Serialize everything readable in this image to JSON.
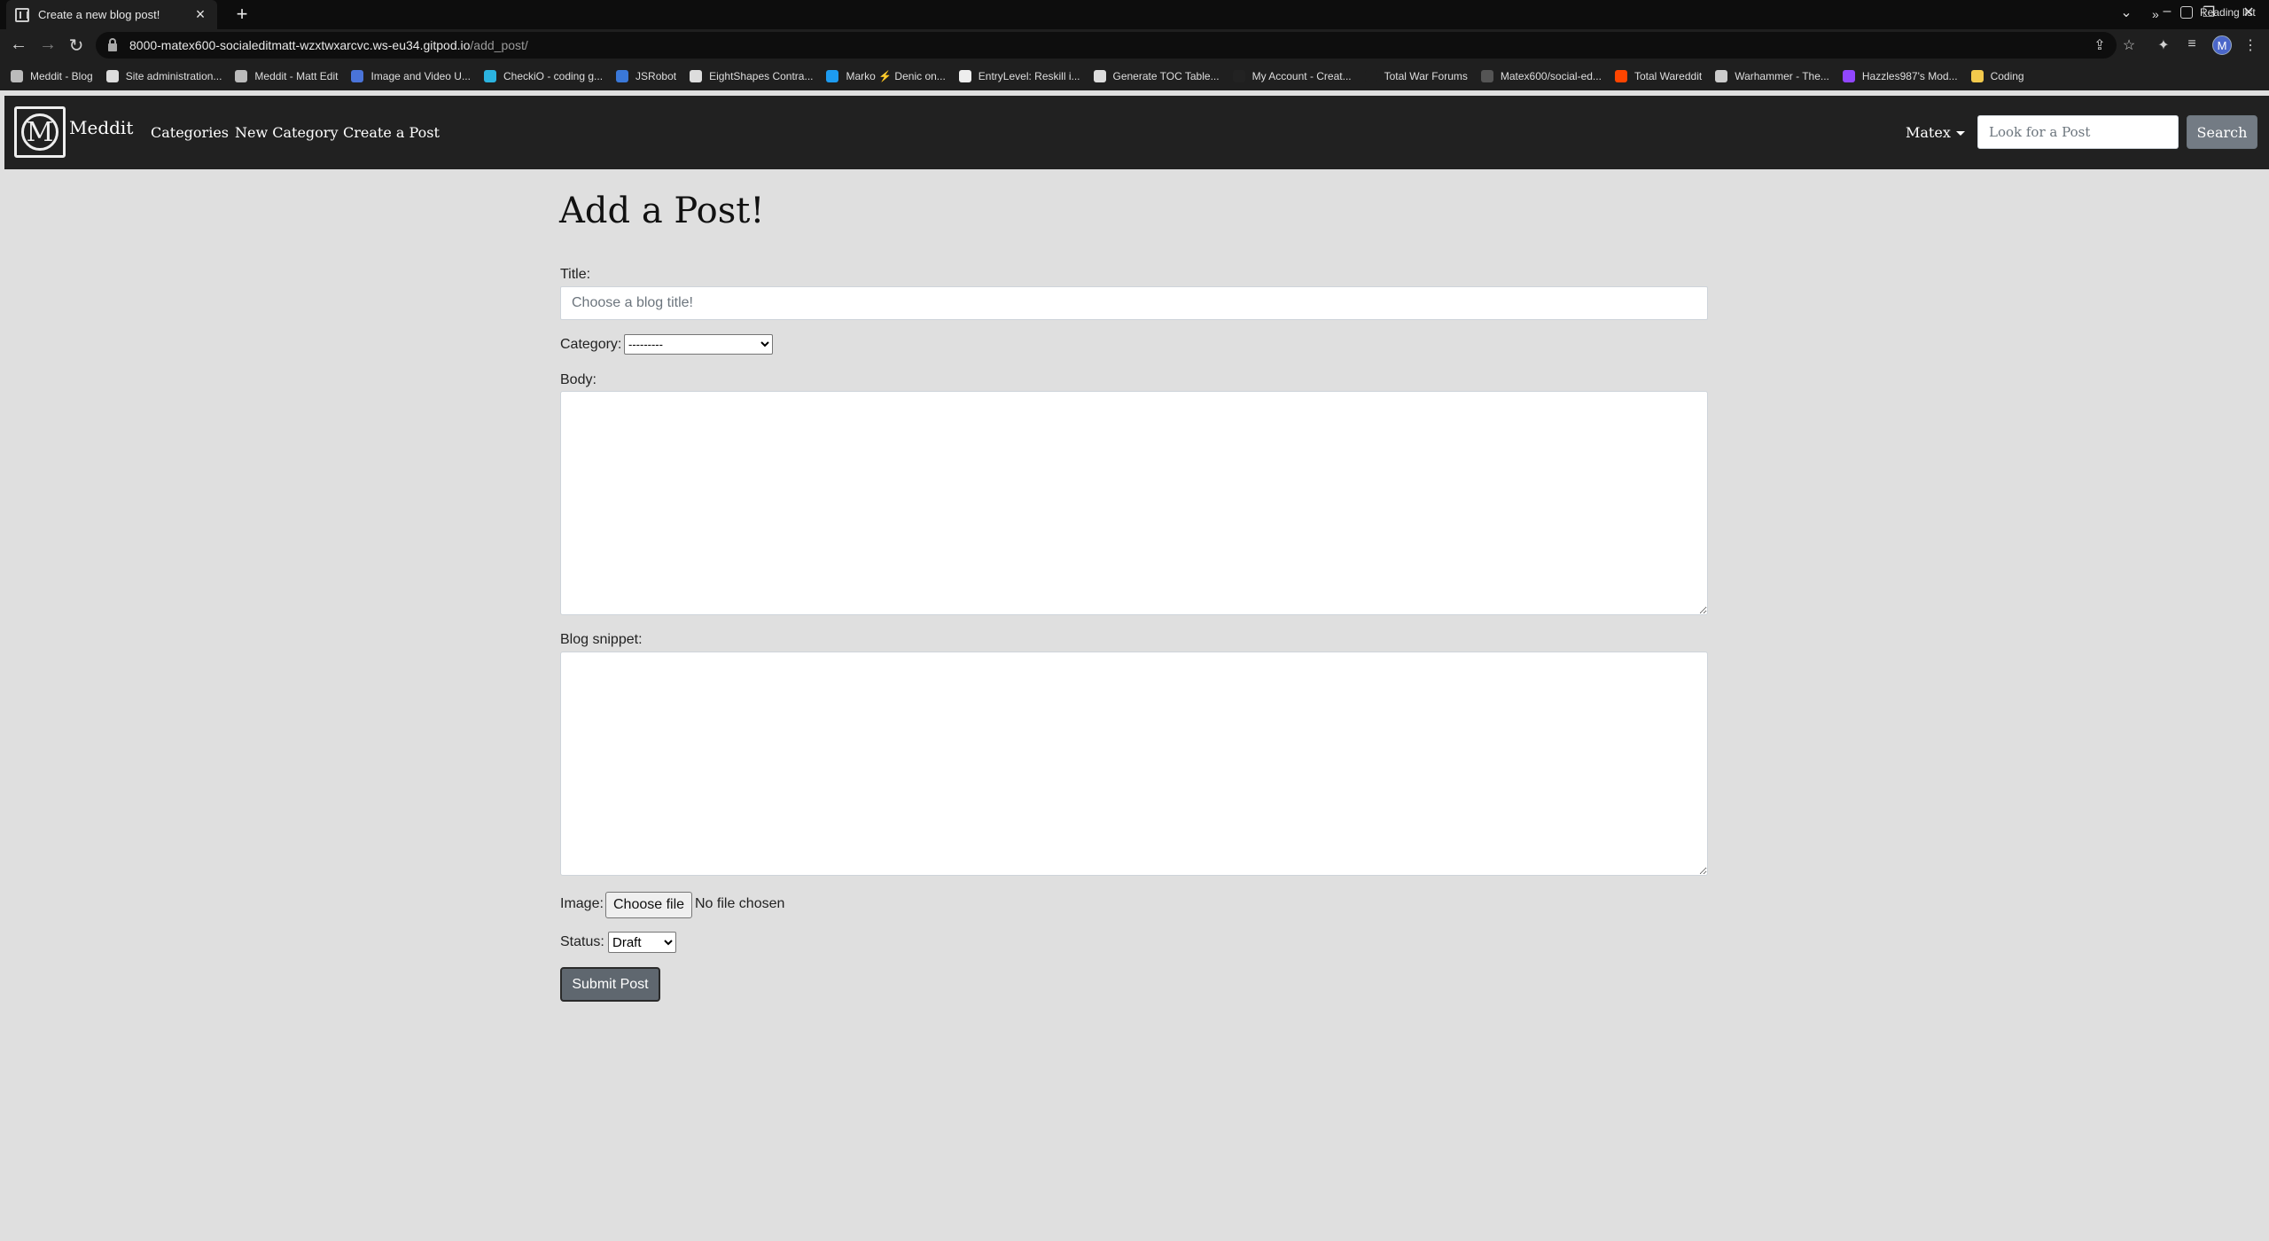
{
  "browser": {
    "tab_title": "Create a new blog post!",
    "url_host": "8000-matex600-socialeditmatt-wzxtwxarcvc.ws-eu34.gitpod.io",
    "url_path": "/add_post/",
    "profile_initial": "M",
    "bookmarks": [
      {
        "label": "Meddit - Blog",
        "color": "#bbbbbb"
      },
      {
        "label": "Site administration...",
        "color": "#dddddd"
      },
      {
        "label": "Meddit - Matt Edit",
        "color": "#bbbbbb"
      },
      {
        "label": "Image and Video U...",
        "color": "#4a74d9"
      },
      {
        "label": "CheckiO - coding g...",
        "color": "#2bb3e0"
      },
      {
        "label": "JSRobot",
        "color": "#3a78d8"
      },
      {
        "label": "EightShapes Contra...",
        "color": "#dddddd"
      },
      {
        "label": "Marko ⚡ Denic on...",
        "color": "#1d9bf0"
      },
      {
        "label": "EntryLevel: Reskill i...",
        "color": "#eeeeee"
      },
      {
        "label": "Generate TOC Table...",
        "color": "#dddddd"
      },
      {
        "label": "My Account - Creat...",
        "color": "#222222"
      },
      {
        "label": "Total War Forums",
        "color": "#1f1f1f"
      },
      {
        "label": "Matex600/social-ed...",
        "color": "#555555"
      },
      {
        "label": "Total Wareddit",
        "color": "#ff4500"
      },
      {
        "label": "Warhammer - The...",
        "color": "#cccccc"
      },
      {
        "label": "Hazzles987's Mod...",
        "color": "#9146ff"
      },
      {
        "label": "Coding",
        "color": "#f2c94c"
      }
    ],
    "more_bookmarks": "»",
    "reading_list": "Reading list"
  },
  "navbar": {
    "brand": "Meddit",
    "links": [
      "Categories",
      "New Category",
      "Create a Post"
    ],
    "user": "Matex",
    "search_placeholder": "Look for a Post",
    "search_button": "Search"
  },
  "form": {
    "heading": "Add a Post!",
    "title_label": "Title:",
    "title_placeholder": "Choose a blog title!",
    "category_label": "Category:",
    "category_selected": "---------",
    "body_label": "Body:",
    "snippet_label": "Blog snippet:",
    "image_label": "Image:",
    "file_button": "Choose file",
    "file_status": "No file chosen",
    "status_label": "Status:",
    "status_selected": "Draft",
    "submit": "Submit Post"
  },
  "colors": {
    "page_bg": "#dfdfdf",
    "navbar_bg": "#212121",
    "submit_bg": "#5f676f",
    "search_btn_bg": "#737b84"
  }
}
